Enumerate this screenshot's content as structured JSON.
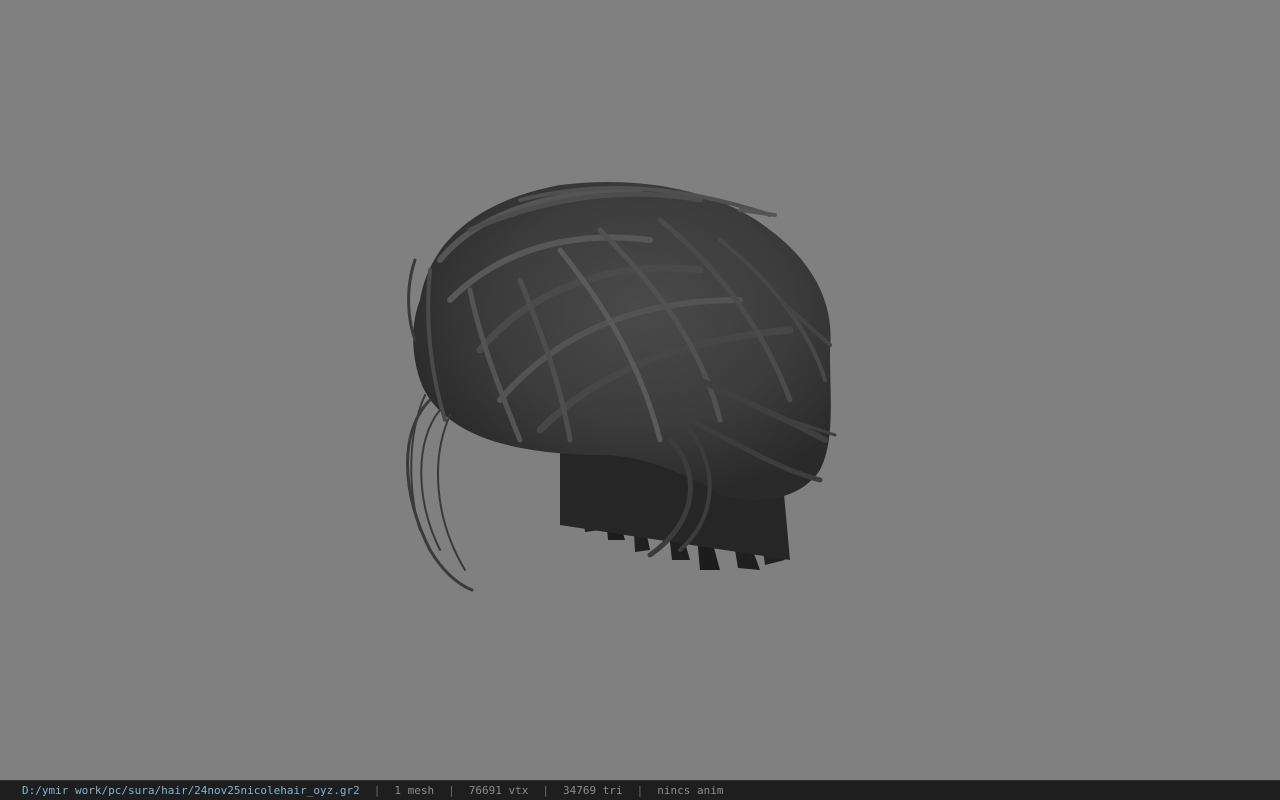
{
  "viewer": {
    "background_color": "#808080",
    "model_color": "#3e3e3e",
    "model_icon": "hair-mesh-render"
  },
  "status": {
    "file_path": "D:/ymir work/pc/sura/hair/24nov25nicolehair_oyz.gr2",
    "separator": "|",
    "mesh_count": "1 mesh",
    "vertex_count": "76691 vtx",
    "triangle_count": "34769 tri",
    "animation": "nincs anim"
  }
}
